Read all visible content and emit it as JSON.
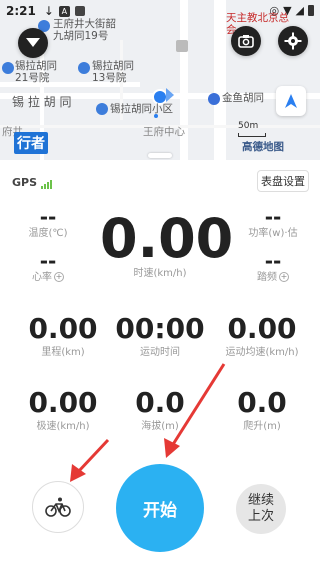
{
  "status_bar": {
    "time": "2:21"
  },
  "map": {
    "labels": {
      "l1": "王府井大街韶",
      "l2": "九胡同19号",
      "l3": "锡拉胡同",
      "l4": "21号院",
      "l5": "锡拉胡同",
      "l6": "13号院",
      "l7": "锡 拉 胡 同",
      "l8": "锡拉胡同小区",
      "l9": "金鱼胡同",
      "l10": "王府中心",
      "l11": "天主教北京总",
      "l12": "会",
      "l13": "东",
      "l14": "府井",
      "l15": "A"
    },
    "brand": "行者",
    "scale_label": "50m",
    "map_provider": "高德地图"
  },
  "panel": {
    "gps_label": "GPS",
    "dial_settings": "表盘设置",
    "temperature": {
      "value": "--",
      "label": "温度(℃)"
    },
    "power": {
      "value": "--",
      "label": "功率(w)·估"
    },
    "heart_rate": {
      "value": "--",
      "label": "心率"
    },
    "cadence": {
      "value": "--",
      "label": "踏频"
    },
    "speed": {
      "value": "0.00",
      "label": "时速(km/h)"
    },
    "distance": {
      "value": "0.00",
      "label": "里程(km)"
    },
    "duration": {
      "value": "00:00",
      "label": "运动时间"
    },
    "avg_speed": {
      "value": "0.00",
      "label": "运动均速(km/h)"
    },
    "max_speed": {
      "value": "0.00",
      "label": "极速(km/h)"
    },
    "altitude": {
      "value": "0.0",
      "label": "海拔(m)"
    },
    "climb": {
      "value": "0.0",
      "label": "爬升(m)"
    }
  },
  "actions": {
    "start": "开始",
    "resume_line1": "继续",
    "resume_line2": "上次"
  },
  "colors": {
    "accent": "#2bb1f2",
    "annotation_arrow": "#e53935",
    "gps_signal": "#6cc24a"
  }
}
